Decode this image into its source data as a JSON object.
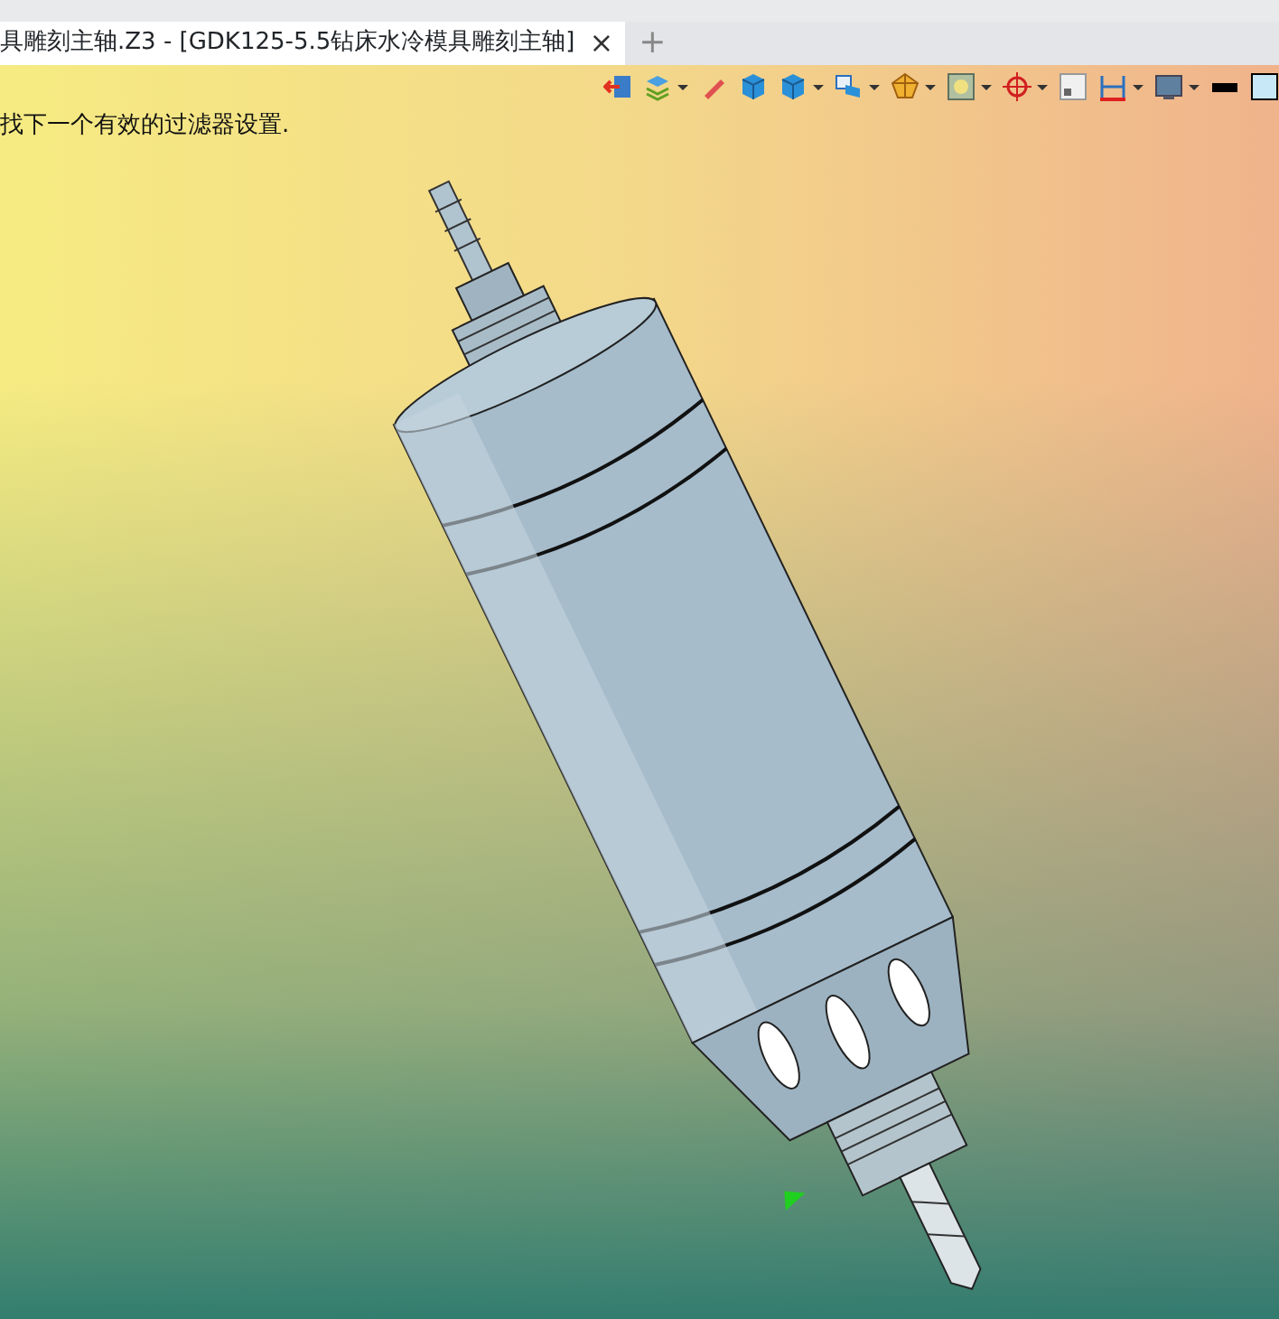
{
  "tab": {
    "title": "具雕刻主轴.Z3 - [GDK125-5.5钻床水冷模具雕刻主轴]",
    "close": "×",
    "selected": true
  },
  "new_tab": "+",
  "toolbar": [
    {
      "kind": "exit",
      "dropdown": false
    },
    {
      "kind": "layers",
      "dropdown": true
    },
    {
      "kind": "pen",
      "dropdown": false
    },
    {
      "kind": "cube",
      "dropdown": false
    },
    {
      "kind": "cube",
      "dropdown": true
    },
    {
      "kind": "view",
      "dropdown": true
    },
    {
      "kind": "wire",
      "dropdown": true
    },
    {
      "kind": "frame",
      "dropdown": true
    },
    {
      "kind": "target",
      "dropdown": true
    },
    {
      "kind": "small",
      "dropdown": false
    },
    {
      "kind": "measure",
      "dropdown": true
    },
    {
      "kind": "screen",
      "dropdown": true
    },
    {
      "kind": "line",
      "dropdown": false
    },
    {
      "kind": "swatch",
      "dropdown": false
    }
  ],
  "message": "找下一个有效的过滤器设置."
}
